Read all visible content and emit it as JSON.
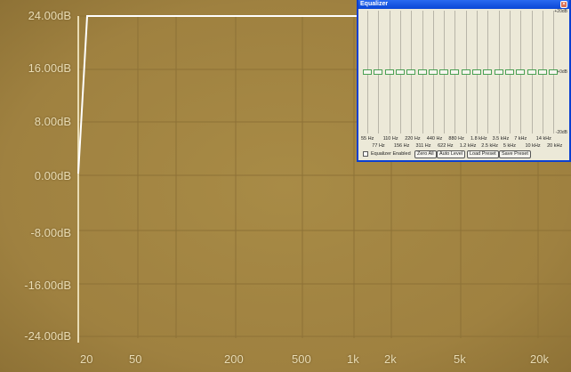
{
  "graph": {
    "y_labels": [
      "24.00dB",
      "16.00dB",
      "8.00dB",
      "0.00dB",
      "-8.00dB",
      "-16.00dB",
      "-24.00dB"
    ],
    "x_labels": [
      "20",
      "50",
      "200",
      "500",
      "1k",
      "2k",
      "5k",
      "20k"
    ]
  },
  "equalizer": {
    "title": "Equalizer",
    "scale_top": "+20dB",
    "scale_mid": "+0dB",
    "scale_bottom": "-20dB",
    "bands": [
      "55 Hz",
      "77 Hz",
      "110 Hz",
      "156 Hz",
      "220 Hz",
      "311 Hz",
      "440 Hz",
      "622 Hz",
      "880 Hz",
      "1.2 kHz",
      "1.8 kHz",
      "2.5 kHz",
      "3.5 kHz",
      "5 kHz",
      "7 kHz",
      "10 kHz",
      "14 kHz",
      "20 kHz"
    ],
    "band_gains_db": [
      0,
      0,
      0,
      0,
      0,
      0,
      0,
      0,
      0,
      0,
      0,
      0,
      0,
      0,
      0,
      0,
      0,
      0
    ],
    "enabled_label": "Equalizer Enabled",
    "enabled": false,
    "buttons": {
      "zero": "Zero All",
      "auto": "Auto Level",
      "load": "Load Preset",
      "save": "Save Preset"
    }
  }
}
